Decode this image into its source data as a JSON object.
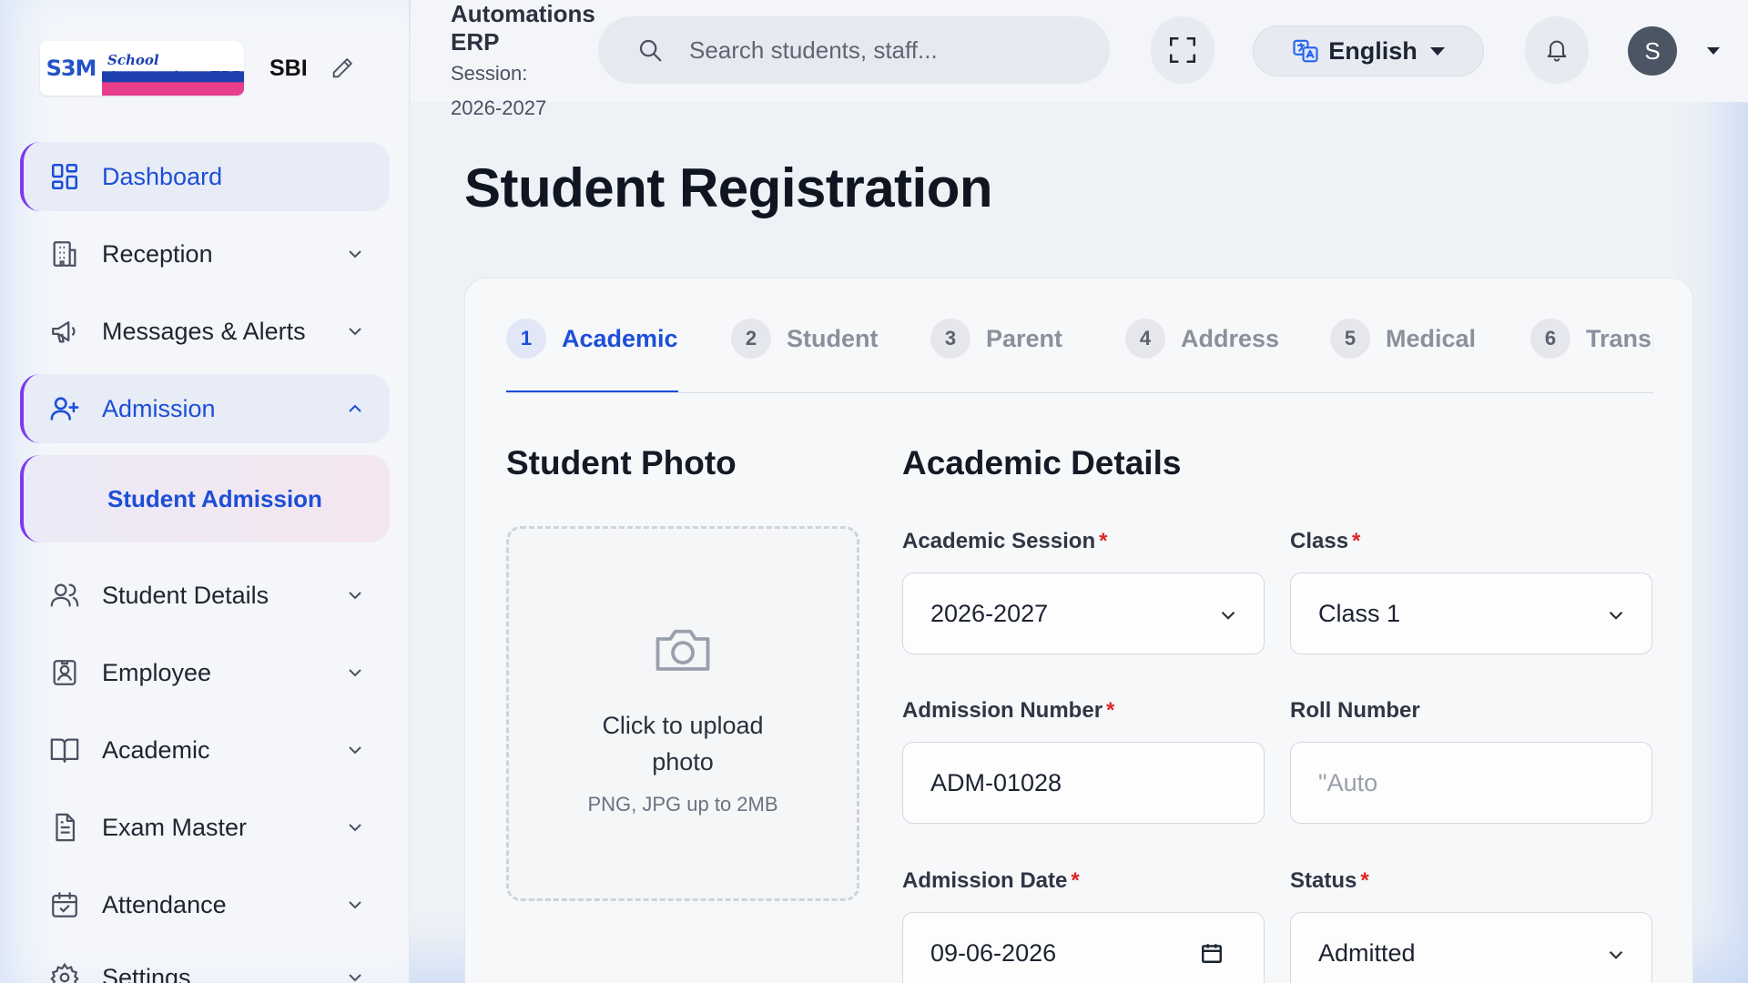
{
  "brand": {
    "short": "SBI",
    "logo_top": "S3M",
    "logo_title": "School Automations ERP"
  },
  "header": {
    "org_name": "Automations ERP",
    "session_label": "Session:",
    "session_value": "2026-2027",
    "search_placeholder": "Search students, staff...",
    "language": "English",
    "avatar_initial": "S"
  },
  "sidebar": {
    "items": [
      {
        "label": "Dashboard",
        "icon": "dashboard-icon"
      },
      {
        "label": "Reception",
        "icon": "building-icon"
      },
      {
        "label": "Messages & Alerts",
        "icon": "megaphone-icon"
      },
      {
        "label": "Admission",
        "icon": "user-plus-icon"
      },
      {
        "label": "Student Admission"
      },
      {
        "label": "Student Details",
        "icon": "users-icon"
      },
      {
        "label": "Employee",
        "icon": "id-badge-icon"
      },
      {
        "label": "Academic",
        "icon": "book-icon"
      },
      {
        "label": "Exam Master",
        "icon": "document-icon"
      },
      {
        "label": "Attendance",
        "icon": "calendar-check-icon"
      },
      {
        "label": "Settings",
        "icon": "gear-icon"
      }
    ]
  },
  "main": {
    "title": "Student Registration",
    "tabs": [
      {
        "num": "1",
        "label": "Academic"
      },
      {
        "num": "2",
        "label": "Student"
      },
      {
        "num": "3",
        "label": "Parent"
      },
      {
        "num": "4",
        "label": "Address"
      },
      {
        "num": "5",
        "label": "Medical"
      },
      {
        "num": "6",
        "label": "Transp"
      }
    ],
    "photo": {
      "title": "Student Photo",
      "upload_text": "Click to upload photo",
      "upload_hint": "PNG, JPG up to 2MB"
    },
    "academic": {
      "title": "Academic Details",
      "session_label": "Academic Session",
      "session_value": "2026-2027",
      "class_label": "Class",
      "class_value": "Class 1",
      "admission_no_label": "Admission Number",
      "admission_no_value": "ADM-01028",
      "roll_label": "Roll Number",
      "roll_placeholder": "\"Auto",
      "date_label": "Admission Date",
      "date_value": "09-06-2026",
      "status_label": "Status",
      "status_value": "Admitted",
      "required_mark": "*"
    }
  },
  "colors": {
    "accent": "#1d4ed8",
    "active_border": "#7c3aed",
    "required": "#dc2626"
  }
}
